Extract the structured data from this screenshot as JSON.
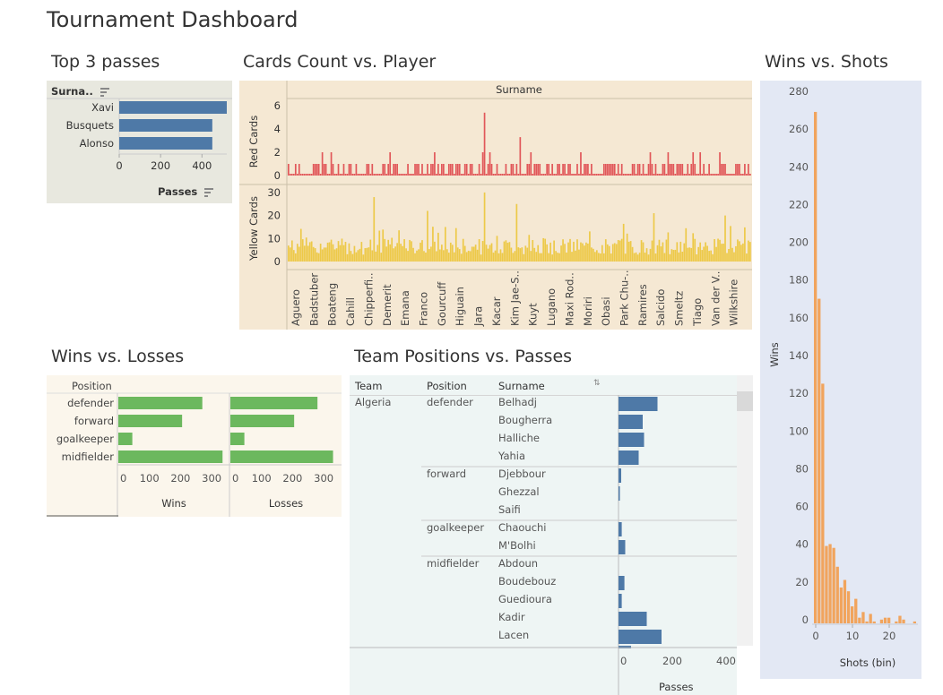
{
  "dashboard": {
    "title": "Tournament Dashboard"
  },
  "top3": {
    "title": "Top 3 passes",
    "header": "Surna..",
    "axis_title": "Passes",
    "ticks": [
      "0",
      "200",
      "400"
    ]
  },
  "cards": {
    "title": "Cards Count vs. Player",
    "header": "Surname",
    "red_label": "Red Cards",
    "yellow_label": "Yellow Cards",
    "red_ticks": [
      "6",
      "4",
      "2",
      "0"
    ],
    "yellow_ticks": [
      "30",
      "20",
      "10",
      "0"
    ],
    "names": [
      "Aguero",
      "Badstuber",
      "Boateng",
      "Cahill",
      "Chipperfi..",
      "Demerit",
      "Emana",
      "Franco",
      "Gourcuff",
      "Higuain",
      "Jara",
      "Kacar",
      "Kim Jae-S..",
      "Kuyt",
      "Lugano",
      "Maxi Rod..",
      "Moriri",
      "Obasi",
      "Park Chu-..",
      "Ramires",
      "Salcido",
      "Smeltz",
      "Tiago",
      "Van der V..",
      "Wilkshire"
    ],
    "colors": {
      "red": "#e15759",
      "yellow": "#edc948"
    }
  },
  "winsshots": {
    "title": "Wins vs. Shots",
    "y_title": "Wins",
    "x_title": "Shots (bin)",
    "y_ticks": [
      "280",
      "260",
      "240",
      "220",
      "200",
      "180",
      "160",
      "140",
      "120",
      "100",
      "80",
      "60",
      "40",
      "20",
      "0"
    ],
    "x_ticks": [
      "0",
      "10",
      "20"
    ],
    "color": "#f1a45d"
  },
  "winslosses": {
    "title": "Wins vs. Losses",
    "header": "Position",
    "wins_title": "Wins",
    "losses_title": "Losses",
    "ticks": [
      "0",
      "100",
      "200",
      "300"
    ],
    "color": "#6cb85e"
  },
  "teampos": {
    "title": "Team Positions vs. Passes",
    "headers": {
      "team": "Team",
      "position": "Position",
      "surname": "Surname"
    },
    "team": "Algeria",
    "axis_title": "Passes",
    "ticks": [
      "0",
      "200",
      "400"
    ],
    "groups": [
      {
        "position": "defender",
        "surnames": [
          "Belhadj",
          "Bougherra",
          "Halliche",
          "Yahia"
        ]
      },
      {
        "position": "forward",
        "surnames": [
          "Djebbour",
          "Ghezzal",
          "Saifi"
        ]
      },
      {
        "position": "goalkeeper",
        "surnames": [
          "Chaouchi",
          "M'Bolhi"
        ]
      },
      {
        "position": "midfielder",
        "surnames": [
          "Abdoun",
          "Boudebouz",
          "Guedioura",
          "Kadir",
          "Lacen"
        ]
      }
    ],
    "color": "#4e79a7"
  },
  "chart_data": [
    {
      "type": "bar",
      "title": "Top 3 passes",
      "categories": [
        "Xavi",
        "Busquets",
        "Alonso"
      ],
      "values": [
        520,
        450,
        450
      ],
      "xlabel": "Passes",
      "xlim": [
        0,
        520
      ],
      "color": "#4e79a7"
    },
    {
      "type": "bar",
      "title": "Wins vs. Losses",
      "categories": [
        "defender",
        "forward",
        "goalkeeper",
        "midfielder"
      ],
      "series": [
        {
          "name": "Wins",
          "values": [
            270,
            205,
            45,
            335
          ]
        },
        {
          "name": "Losses",
          "values": [
            280,
            205,
            45,
            330
          ]
        }
      ]
    },
    {
      "type": "bar",
      "title": "Team Positions vs. Passes",
      "categories": [
        "Belhadj",
        "Bougherra",
        "Halliche",
        "Yahia",
        "Djebbour",
        "Ghezzal",
        "Saifi",
        "Chaouchi",
        "M'Bolhi",
        "Abdoun",
        "Boudebouz",
        "Guedioura",
        "Kadir",
        "Lacen"
      ],
      "values": [
        145,
        90,
        95,
        75,
        10,
        4,
        0,
        12,
        25,
        0,
        22,
        12,
        105,
        160
      ],
      "xlabel": "Passes",
      "xlim": [
        0,
        450
      ]
    },
    {
      "type": "bar",
      "title": "Wins vs. Shots",
      "x": [
        0,
        1,
        2,
        3,
        4,
        5,
        6,
        7,
        8,
        9,
        10,
        11,
        12,
        13,
        14,
        15,
        16,
        17,
        18,
        19,
        20,
        21,
        22,
        23,
        24,
        25,
        26,
        27
      ],
      "values": [
        271,
        172,
        127,
        41,
        42,
        40,
        30,
        19,
        23,
        17,
        9,
        13,
        3,
        6,
        1,
        5,
        1,
        0,
        2,
        3,
        3,
        0,
        1,
        4,
        2,
        0,
        0,
        1
      ],
      "xlabel": "Shots (bin)",
      "ylabel": "Wins",
      "ylim": [
        0,
        280
      ]
    }
  ]
}
